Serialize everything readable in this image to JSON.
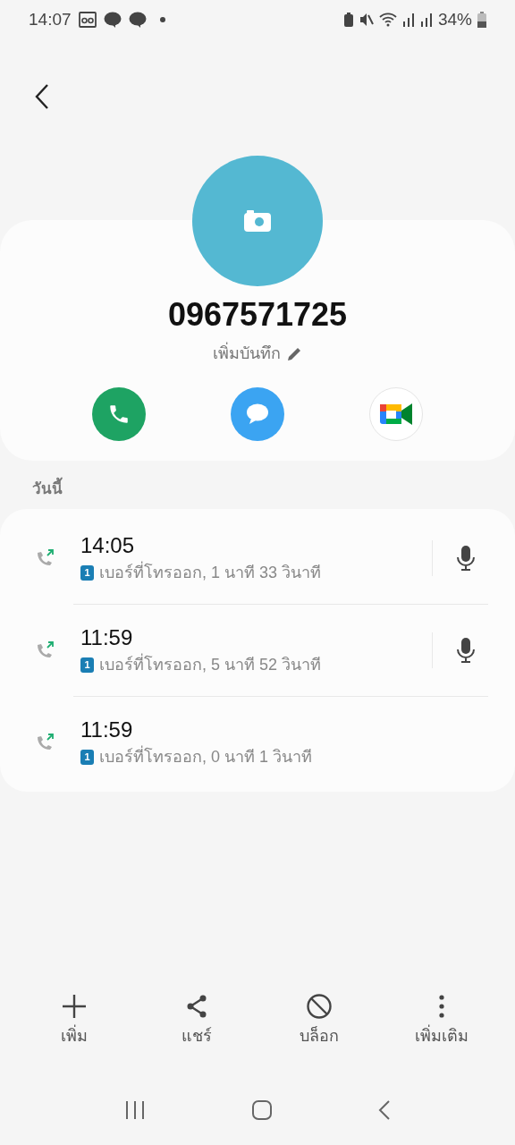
{
  "status_bar": {
    "time": "14:07",
    "battery": "34%"
  },
  "contact": {
    "number": "0967571725",
    "note_label": "เพิ่มบันทึก"
  },
  "quick_actions": [
    {
      "kind": "call"
    },
    {
      "kind": "message"
    },
    {
      "kind": "video"
    }
  ],
  "section_label": "วันนี้",
  "calls": [
    {
      "time": "14:05",
      "sim": "1",
      "detail": "เบอร์ที่โทรออก, 1 นาที 33 วินาที",
      "recording": true
    },
    {
      "time": "11:59",
      "sim": "1",
      "detail": "เบอร์ที่โทรออก, 5 นาที 52 วินาที",
      "recording": true
    },
    {
      "time": "11:59",
      "sim": "1",
      "detail": "เบอร์ที่โทรออก, 0 นาที 1 วินาที",
      "recording": false
    }
  ],
  "bottom_actions": [
    {
      "kind": "add",
      "label": "เพิ่ม"
    },
    {
      "kind": "share",
      "label": "แชร์"
    },
    {
      "kind": "block",
      "label": "บล็อก"
    },
    {
      "kind": "more",
      "label": "เพิ่มเติม"
    }
  ]
}
